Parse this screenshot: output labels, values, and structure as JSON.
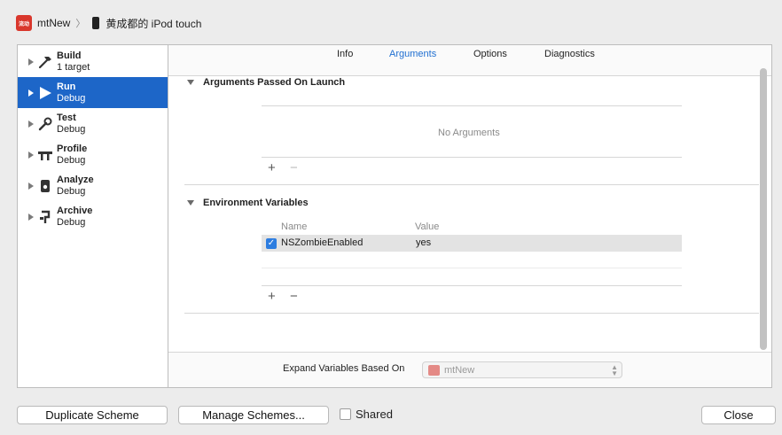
{
  "breadcrumb": {
    "app_icon_text": "流动",
    "scheme": "mtNew",
    "device": "黄成都的 iPod touch"
  },
  "sidebar": {
    "items": [
      {
        "title": "Build",
        "subtitle": "1 target",
        "icon": "hammer-icon",
        "selected": false
      },
      {
        "title": "Run",
        "subtitle": "Debug",
        "icon": "play-icon",
        "selected": true
      },
      {
        "title": "Test",
        "subtitle": "Debug",
        "icon": "wrench-icon",
        "selected": false
      },
      {
        "title": "Profile",
        "subtitle": "Debug",
        "icon": "caliper-icon",
        "selected": false
      },
      {
        "title": "Analyze",
        "subtitle": "Debug",
        "icon": "analyze-icon",
        "selected": false
      },
      {
        "title": "Archive",
        "subtitle": "Debug",
        "icon": "archive-icon",
        "selected": false
      }
    ]
  },
  "tabs": [
    {
      "label": "Info",
      "active": false
    },
    {
      "label": "Arguments",
      "active": true
    },
    {
      "label": "Options",
      "active": false
    },
    {
      "label": "Diagnostics",
      "active": false
    }
  ],
  "arguments": {
    "header": "Arguments Passed On Launch",
    "empty_text": "No Arguments",
    "add_label": "+",
    "remove_label": "−"
  },
  "environment": {
    "header": "Environment Variables",
    "col_name": "Name",
    "col_value": "Value",
    "rows": [
      {
        "name": "NSZombieEnabled",
        "value": "yes",
        "enabled": true
      }
    ],
    "add_label": "+",
    "remove_label": "−"
  },
  "expand": {
    "label": "Expand Variables Based On",
    "selected": "mtNew"
  },
  "buttons": {
    "duplicate": "Duplicate Scheme",
    "manage": "Manage Schemes...",
    "shared": "Shared",
    "close": "Close"
  },
  "colors": {
    "accent": "#1d66c8",
    "active_tab": "#1f6fd1",
    "checkbox": "#2d7de0"
  }
}
